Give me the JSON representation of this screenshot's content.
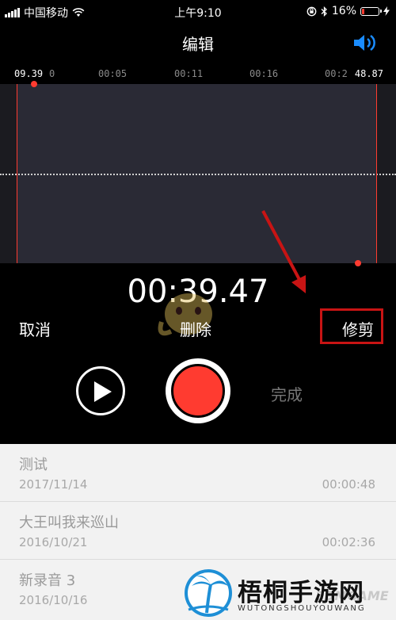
{
  "status_bar": {
    "carrier": "中国移动",
    "time": "上午9:10",
    "battery": "16%",
    "battery_level": 0.16
  },
  "nav": {
    "title": "编辑",
    "speaker_icon": "speaker-volume-icon"
  },
  "timeline": {
    "start": "09.39",
    "end": "48.87",
    "ticks": [
      "0",
      "00:05",
      "00:11",
      "00:16",
      "00:2"
    ]
  },
  "timer": "00:39.47",
  "controls": {
    "cancel": "取消",
    "delete": "删除",
    "trim": "修剪",
    "done": "完成"
  },
  "colors": {
    "accent_red": "#ff3b30",
    "highlight_box": "#c81414",
    "link_blue": "#1a8cff"
  },
  "recordings": [
    {
      "title": "测试",
      "date": "2017/11/14",
      "duration": "00:00:48"
    },
    {
      "title": "大王叫我来巡山",
      "date": "2016/10/21",
      "duration": "00:02:36"
    },
    {
      "title": "新录音 3",
      "date": "2016/10/16",
      "duration": ""
    }
  ],
  "watermark": {
    "brand": "梧桐手游网",
    "pinyin": "WUTONGSHOUYOUWANG",
    "site": "3DMGAME"
  }
}
